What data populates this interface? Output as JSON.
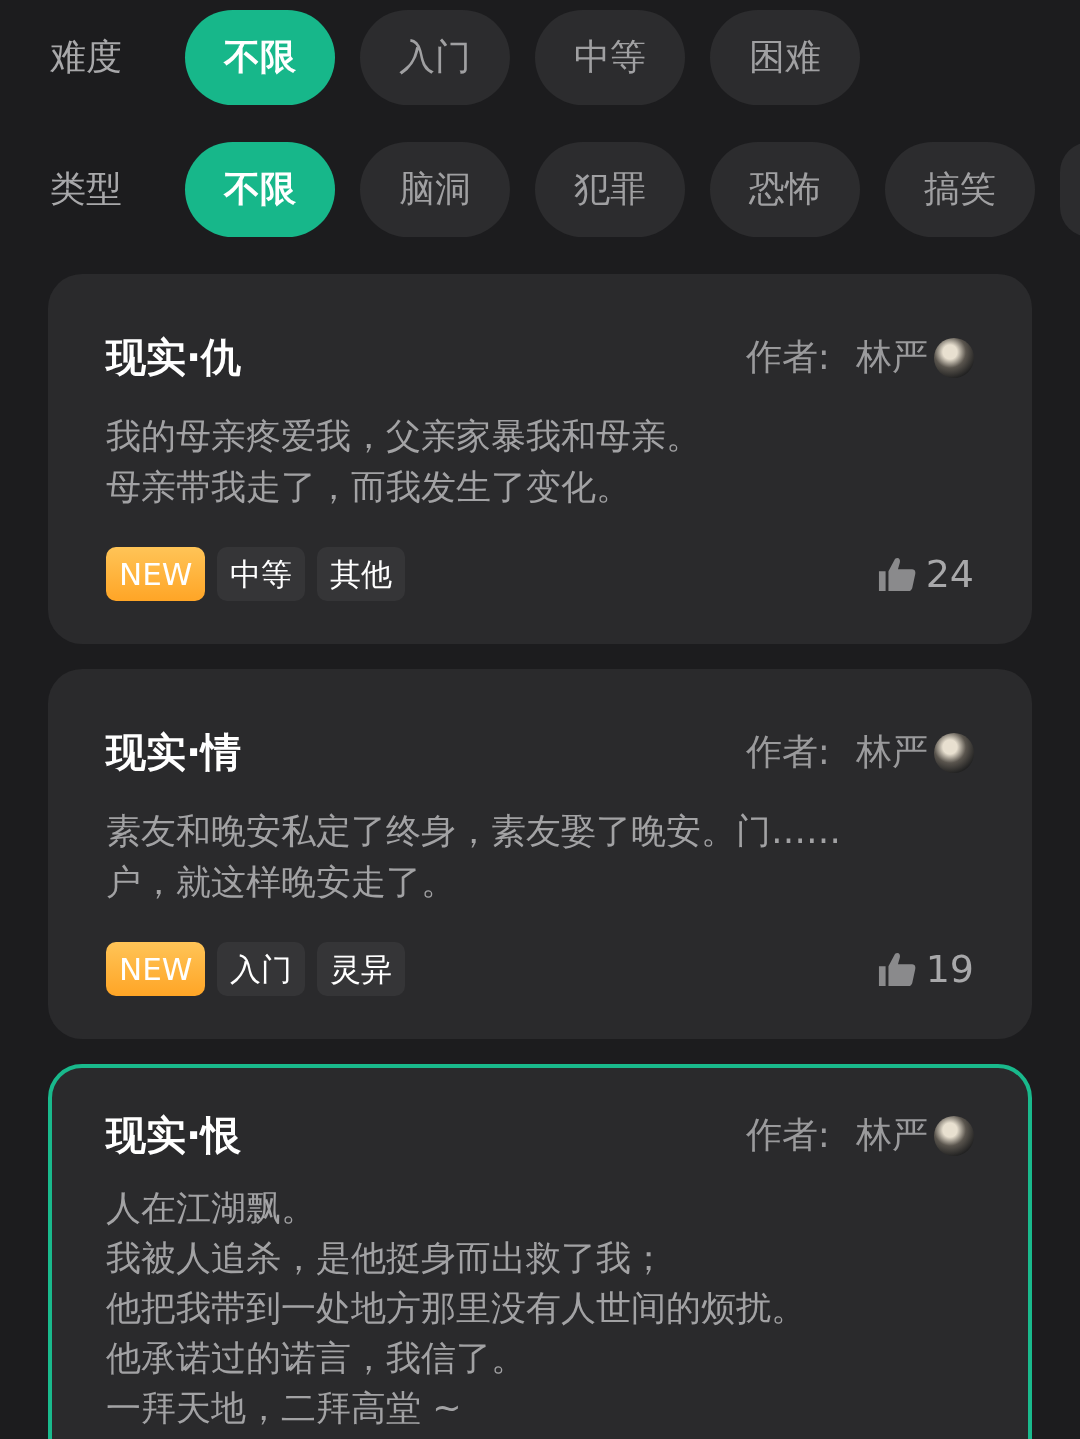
{
  "filters": [
    {
      "label": "难度",
      "options": [
        {
          "label": "不限",
          "selected": true
        },
        {
          "label": "入门",
          "selected": false
        },
        {
          "label": "中等",
          "selected": false
        },
        {
          "label": "困难",
          "selected": false
        }
      ]
    },
    {
      "label": "类型",
      "options": [
        {
          "label": "不限",
          "selected": true
        },
        {
          "label": "脑洞",
          "selected": false
        },
        {
          "label": "犯罪",
          "selected": false
        },
        {
          "label": "恐怖",
          "selected": false
        },
        {
          "label": "搞笑",
          "selected": false
        }
      ],
      "cut_off_option": true
    }
  ],
  "stories": [
    {
      "title": "现实·仇",
      "author_label": "作者:",
      "author": "林严",
      "description": [
        "我的母亲疼爱我，父亲家暴我和母亲。",
        "母亲带我走了，而我发生了变化。"
      ],
      "tags": [
        {
          "label": "NEW",
          "kind": "new"
        },
        {
          "label": "中等",
          "kind": "plain"
        },
        {
          "label": "其他",
          "kind": "plain"
        }
      ],
      "likes": "24",
      "selected": false
    },
    {
      "title": "现实·情",
      "author_label": "作者:",
      "author": "林严",
      "description": [
        "素友和晚安私定了终身，素友娶了晚安。门……",
        "户，就这样晚安走了。"
      ],
      "tags": [
        {
          "label": "NEW",
          "kind": "new"
        },
        {
          "label": "入门",
          "kind": "plain"
        },
        {
          "label": "灵异",
          "kind": "plain"
        }
      ],
      "likes": "19",
      "selected": false
    },
    {
      "title": "现实·恨",
      "author_label": "作者:",
      "author": "林严",
      "description": [
        "人在江湖飘。",
        "我被人追杀，是他挺身而出救了我；",
        "他把我带到一处地方那里没有人世间的烦扰。",
        "他承诺过的诺言，我信了。",
        "一拜天地，二拜高堂 ~"
      ],
      "selected": true
    }
  ]
}
